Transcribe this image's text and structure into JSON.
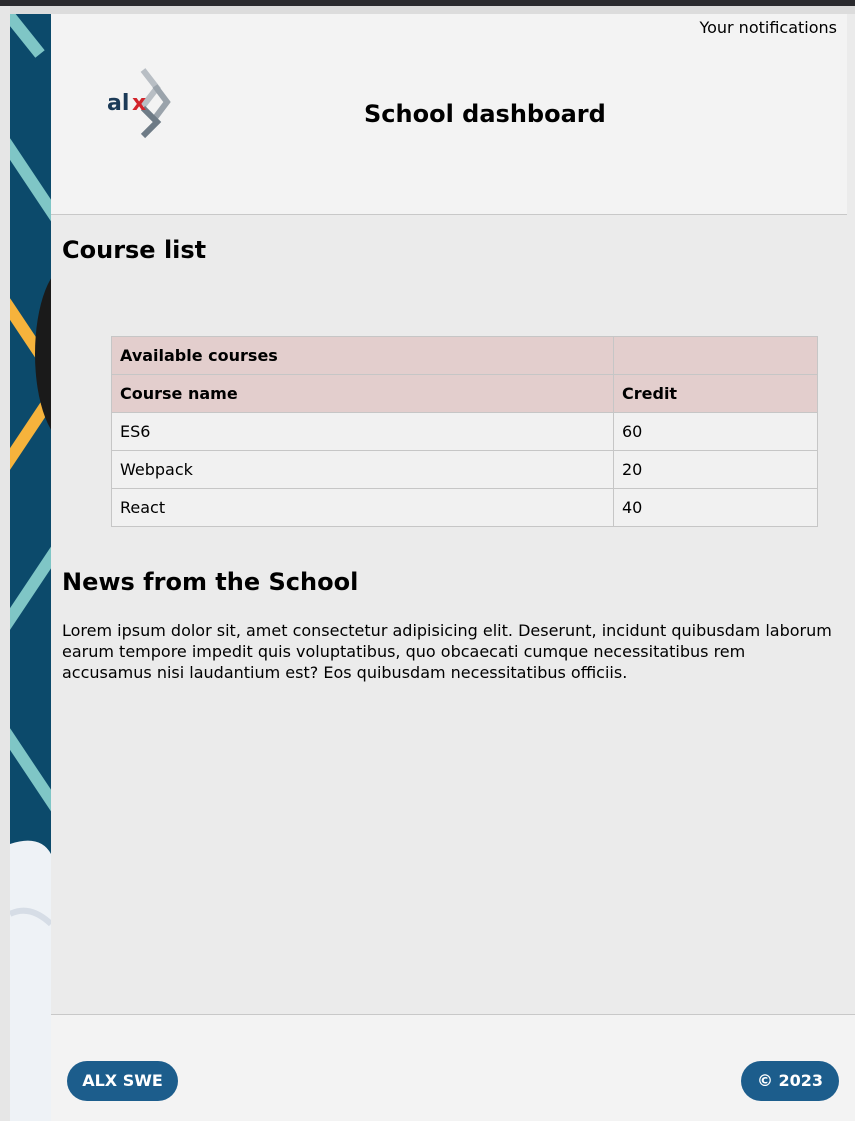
{
  "header": {
    "notifications_label": "Your notifications",
    "logo_text": "alx",
    "title": "School dashboard"
  },
  "course_list": {
    "title": "Course list",
    "table": {
      "caption_header": "Available courses",
      "columns": [
        "Course name",
        "Credit"
      ],
      "rows": [
        {
          "name": "ES6",
          "credit": "60"
        },
        {
          "name": "Webpack",
          "credit": "20"
        },
        {
          "name": "React",
          "credit": "40"
        }
      ]
    }
  },
  "news": {
    "title": "News from the School",
    "body": "Lorem ipsum dolor sit, amet consectetur adipisicing elit. Deserunt, incidunt quibusdam laborum earum tempore impedit quis voluptatibus, quo obcaecati cumque necessitatibus rem accusamus nisi laudantium est? Eos quibusdam necessitatibus officiis."
  },
  "footer": {
    "left_badge": "ALX SWE",
    "right_badge": "© 2023"
  },
  "colors": {
    "brand_blue": "#1c5d8c",
    "table_header_bg": "#e3cecd",
    "alx_red": "#d2232a",
    "alx_navy": "#1b3a57"
  }
}
